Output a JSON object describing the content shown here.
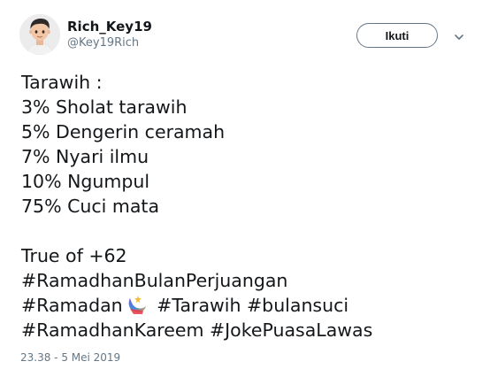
{
  "tweet": {
    "display_name": "Rich_Key19",
    "handle": "@Key19Rich",
    "follow_label": "Ikuti",
    "avatar_icon": "memoji-avatar",
    "caret_icon": "chevron-down-icon",
    "lines": [
      "Tarawih :",
      "3% Sholat tarawih",
      "5% Dengerin ceramah",
      "7% Nyari ilmu",
      "10% Ngumpul",
      "75% Cuci mata"
    ],
    "lines2": [
      "True of +62",
      "#RamadhanBulanPerjuangan"
    ],
    "ramadan_tag": "#Ramadan",
    "emoji_icon": "crescent-moon-emoji-icon",
    "tags_after_emoji": "#Tarawih #bulansuci",
    "last_line": "#RamadhanKareem #JokePuasaLawas",
    "timestamp": "23.38 - 5 Mei 2019"
  },
  "colors": {
    "text": "#14171a",
    "secondary": "#657786",
    "background": "#ffffff"
  }
}
